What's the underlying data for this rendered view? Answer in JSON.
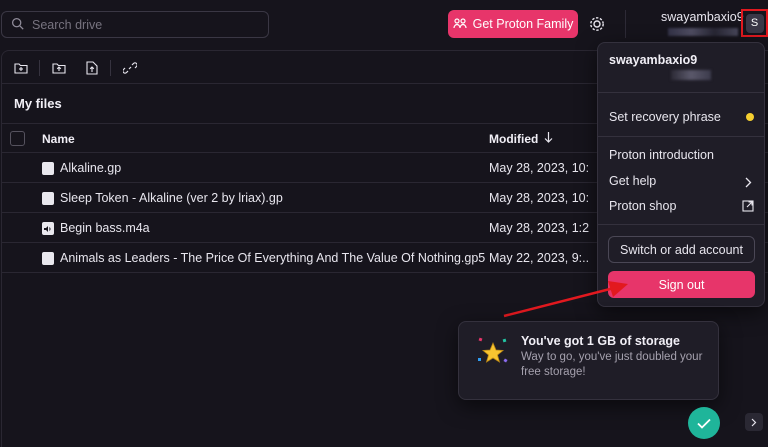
{
  "search": {
    "placeholder": "Search drive",
    "icon": "search-icon"
  },
  "header": {
    "cta_label": "Get Proton Family",
    "cta_color": "#e7356a",
    "username": "swayambaxio9",
    "avatar_initial": "S"
  },
  "toolbar": {
    "icons": [
      "new-folder-icon",
      "upload-folder-icon",
      "upload-file-icon",
      "link-icon"
    ]
  },
  "main": {
    "title": "My files",
    "columns": {
      "name": "Name",
      "modified": "Modified"
    },
    "files": [
      {
        "name": "Alkaline.gp",
        "modified": "May 28, 2023, 10:...",
        "icon": "file-icon"
      },
      {
        "name": "Sleep Token - Alkaline (ver 2 by lriax).gp",
        "modified": "May 28, 2023, 10:...",
        "icon": "file-icon"
      },
      {
        "name": "Begin bass.m4a",
        "modified": "May 28, 2023, 1:2...",
        "icon": "audio-file-icon"
      },
      {
        "name": "Animals as Leaders - The Price Of Everything And The Value Of Nothing.gp5",
        "modified": "May 22, 2023, 9:...",
        "icon": "file-icon"
      }
    ]
  },
  "dropdown": {
    "username": "swayambaxio9",
    "items": {
      "recovery": "Set recovery phrase",
      "intro": "Proton introduction",
      "help": "Get help",
      "shop": "Proton shop"
    },
    "switch_label": "Switch or add account",
    "signout_label": "Sign out",
    "status_color": "#f5cf30"
  },
  "notification": {
    "title": "You've got 1 GB of storage",
    "body": "Way to go, you've just doubled your free storage!"
  },
  "colors": {
    "accent": "#e7356a",
    "success": "#1fb59a",
    "highlight": "#e2191f"
  }
}
